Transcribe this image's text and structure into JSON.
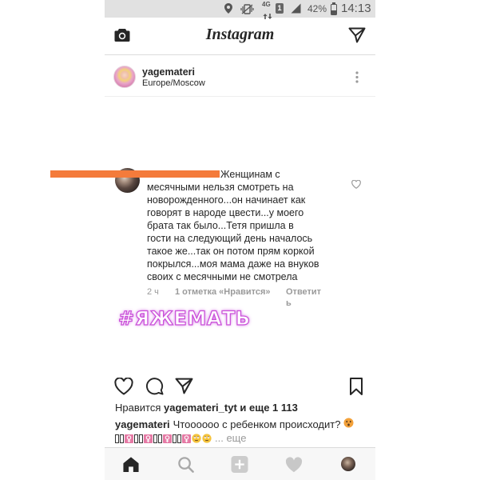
{
  "colors": {
    "censor_orange": "#f47b3b",
    "hashtag_glow": "#c94fd8",
    "status_bar_bg": "#e1e1e1",
    "text": "#262626",
    "muted": "#9a9a9a"
  },
  "status_bar": {
    "network": "4G",
    "sim": "1",
    "battery_percent": "42%",
    "battery_level": 0.42,
    "time": "14:13",
    "icons": [
      "location-icon",
      "vibrate-mute-icon",
      "signal-icon",
      "battery-icon"
    ]
  },
  "header": {
    "logo": "Instagram",
    "left_icon": "camera-icon",
    "right_icon": "direct-message-icon"
  },
  "post": {
    "username": "yagemateri",
    "location": "Europe/Moscow",
    "menu_icon": "more-options-icon",
    "image": {
      "comment": {
        "first_line": "Женщинам с",
        "lines": [
          "месячными нельзя смотреть на",
          "новорожденного...он начинает как",
          "говорят в народе цвести...у моего",
          "брата так было...Тетя пришла в",
          "гости на следующий день началось",
          "такое же...так он потом прям коркой",
          "покрылся...моя мама даже на внуков",
          "своих с месячными не смотрела"
        ],
        "time": "2 ч",
        "likes": "1 отметка «Нравится»",
        "reply_part1": "Ответит",
        "reply_part2": "ь",
        "like_icon": "heart-icon"
      },
      "hashtag": "#ЯЖЕМАТЬ"
    },
    "actions": [
      "like-heart-icon",
      "comment-icon",
      "share-icon",
      "bookmark-icon"
    ],
    "likes": {
      "prefix": "Нравится",
      "user": "yagemateri_tyt",
      "suffix": "и еще 1 113"
    },
    "caption": {
      "username": "yagemateri",
      "text": "Чтоооооо с ребенком происходит?",
      "end_emoji": "hushed-face-emoji-icon",
      "emoji_row": [
        "missing-glyph-icon",
        "missing-glyph-icon",
        "female-sign-icon",
        "missing-glyph-icon",
        "missing-glyph-icon",
        "female-sign-icon",
        "missing-glyph-icon",
        "missing-glyph-icon",
        "female-sign-icon",
        "missing-glyph-icon",
        "missing-glyph-icon",
        "female-sign-icon",
        "rolling-eyes-face-icon",
        "rolling-eyes-face-icon"
      ],
      "more": "... еще"
    }
  },
  "bottom_nav": [
    "home-icon",
    "search-icon",
    "add-post-icon",
    "activity-heart-icon",
    "profile-avatar"
  ]
}
